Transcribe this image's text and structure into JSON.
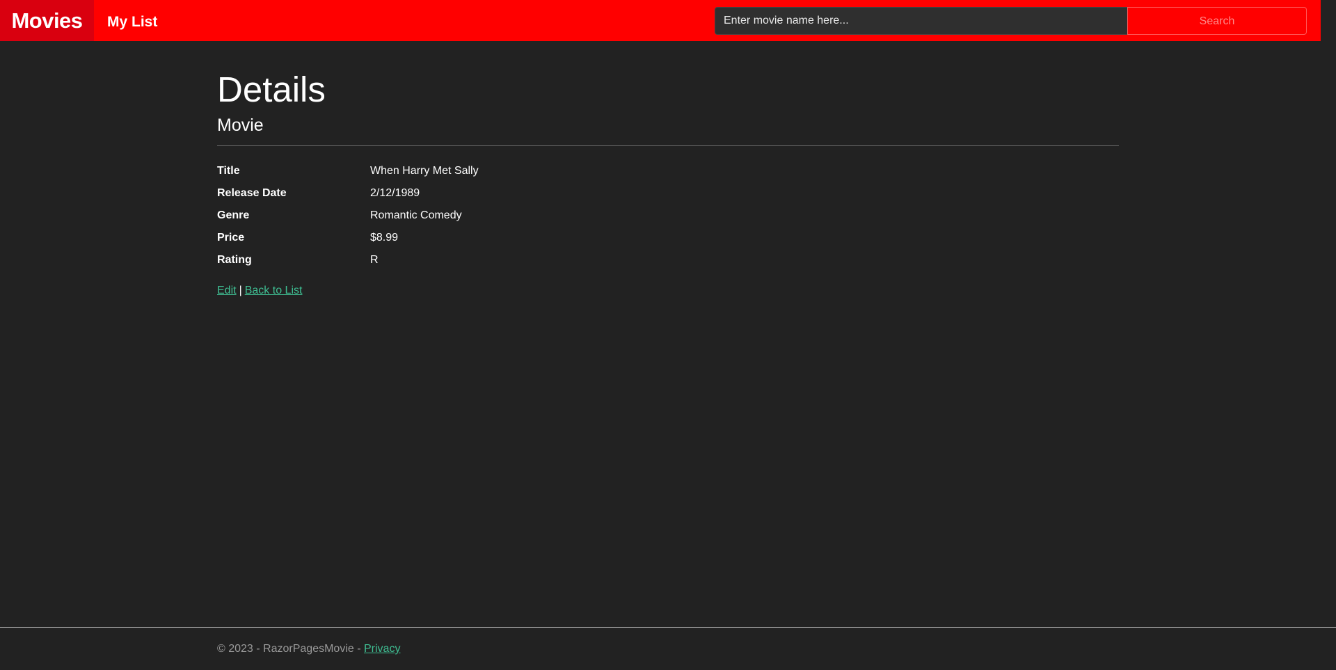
{
  "navbar": {
    "brand": "Movies",
    "my_list": "My List",
    "search_placeholder": "Enter movie name here...",
    "search_button": "Search"
  },
  "page": {
    "title": "Details",
    "subtitle": "Movie"
  },
  "movie": {
    "fields": [
      {
        "label": "Title",
        "value": "When Harry Met Sally"
      },
      {
        "label": "Release Date",
        "value": "2/12/1989"
      },
      {
        "label": "Genre",
        "value": "Romantic Comedy"
      },
      {
        "label": "Price",
        "value": "$8.99"
      },
      {
        "label": "Rating",
        "value": "R"
      }
    ]
  },
  "actions": {
    "edit": "Edit",
    "separator": "|",
    "back": "Back to List"
  },
  "footer": {
    "copyright": "© 2023 - RazorPagesMovie - ",
    "privacy": "Privacy"
  },
  "colors": {
    "navbar": "#ff0000",
    "brand_bg": "#d9000f",
    "background": "#222222",
    "link": "#3fbf93"
  }
}
